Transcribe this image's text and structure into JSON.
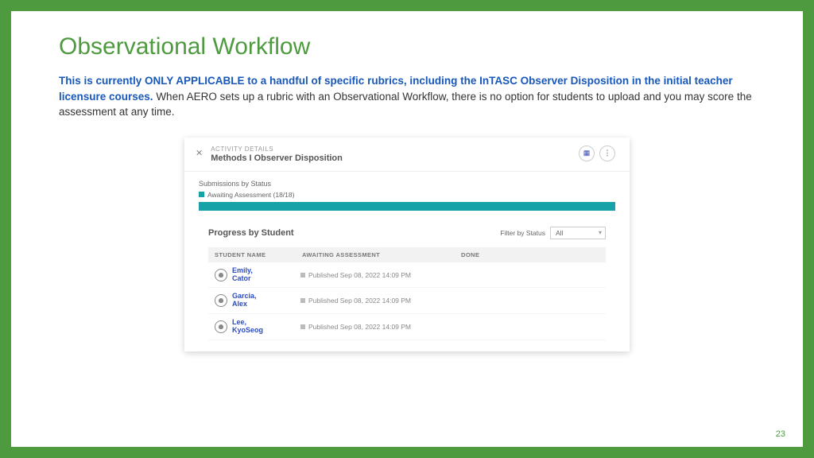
{
  "slide": {
    "title": "Observational Workflow",
    "emph": "This is currently ONLY APPLICABLE to a handful of specific rubrics, including the InTASC Observer Disposition in the initial teacher licensure courses.",
    "rest": " When AERO sets up a rubric with an Observational Workflow, there is no option for students to upload and you may score the assessment at any time.",
    "page": "23"
  },
  "panel": {
    "detailsLabel": "ACTIVITY DETAILS",
    "title": "Methods I Observer Disposition",
    "statusLabel": "Submissions by Status",
    "legend": "Awaiting Assessment (18/18)",
    "progressTitle": "Progress by Student",
    "filterLabel": "Filter by Status",
    "filterValue": "All",
    "cols": {
      "name": "STUDENT NAME",
      "await": "AWAITING ASSESSMENT",
      "done": "DONE"
    },
    "pubPrefix": "Published ",
    "rows": [
      {
        "name": "Emily, Cator",
        "ts": "Sep 08, 2022 14:09 PM"
      },
      {
        "name": "Garcia, Alex",
        "ts": "Sep 08, 2022 14:09 PM"
      },
      {
        "name": "Lee, KyoSeog",
        "ts": "Sep 08, 2022 14:09 PM"
      }
    ]
  }
}
